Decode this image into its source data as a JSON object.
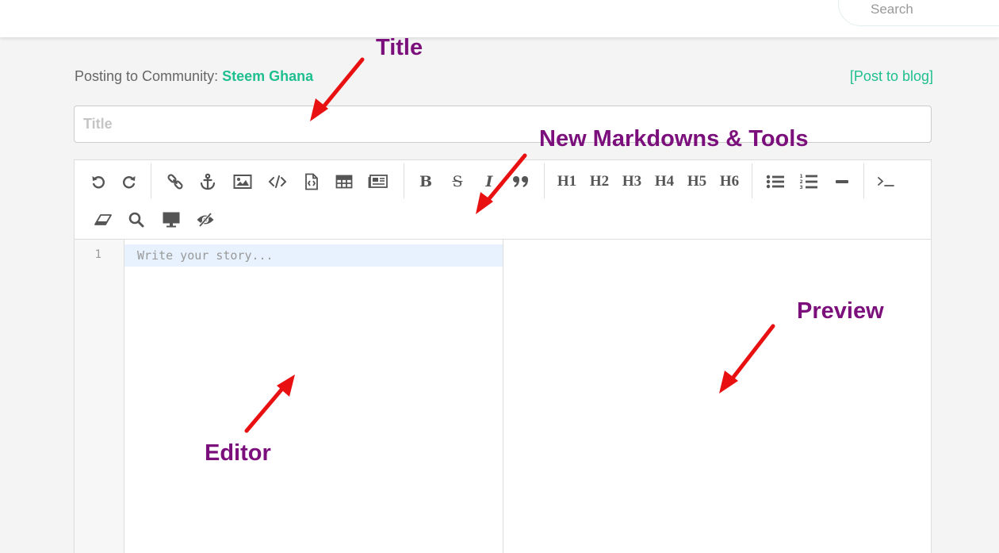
{
  "header": {
    "search_placeholder": "Search"
  },
  "posting": {
    "prefix": "Posting to Community:",
    "community": "Steem Ghana",
    "post_to_blog": "[Post to blog]"
  },
  "title_field": {
    "placeholder": "Title",
    "value": ""
  },
  "toolbar": {
    "row1": [
      "undo-icon",
      "redo-icon",
      "link-icon",
      "anchor-icon",
      "image-icon",
      "code-icon",
      "code-file-icon",
      "table-icon",
      "article-icon",
      "bold",
      "strikethrough",
      "italic",
      "quote-icon",
      "H1",
      "H2",
      "H3",
      "H4",
      "H5",
      "H6",
      "unordered-list-icon",
      "ordered-list-icon",
      "horizontal-rule-icon",
      "terminal-icon"
    ],
    "row2": [
      "eraser-icon",
      "search-icon",
      "monitor-icon",
      "eye-slash-icon"
    ],
    "bold": "B",
    "strike": "S",
    "italic": "I",
    "h1": "H1",
    "h2": "H2",
    "h3": "H3",
    "h4": "H4",
    "h5": "H5",
    "h6": "H6"
  },
  "editor": {
    "line_number": "1",
    "placeholder": "Write your story..."
  },
  "annotations": {
    "title": "Title",
    "tools": "New Markdowns & Tools",
    "preview": "Preview",
    "editor": "Editor"
  },
  "colors": {
    "accent_green": "#1fbf8f",
    "annotation_purple": "#7b0f7b",
    "arrow_red": "#e81010",
    "active_line": "#e8f2fe"
  }
}
